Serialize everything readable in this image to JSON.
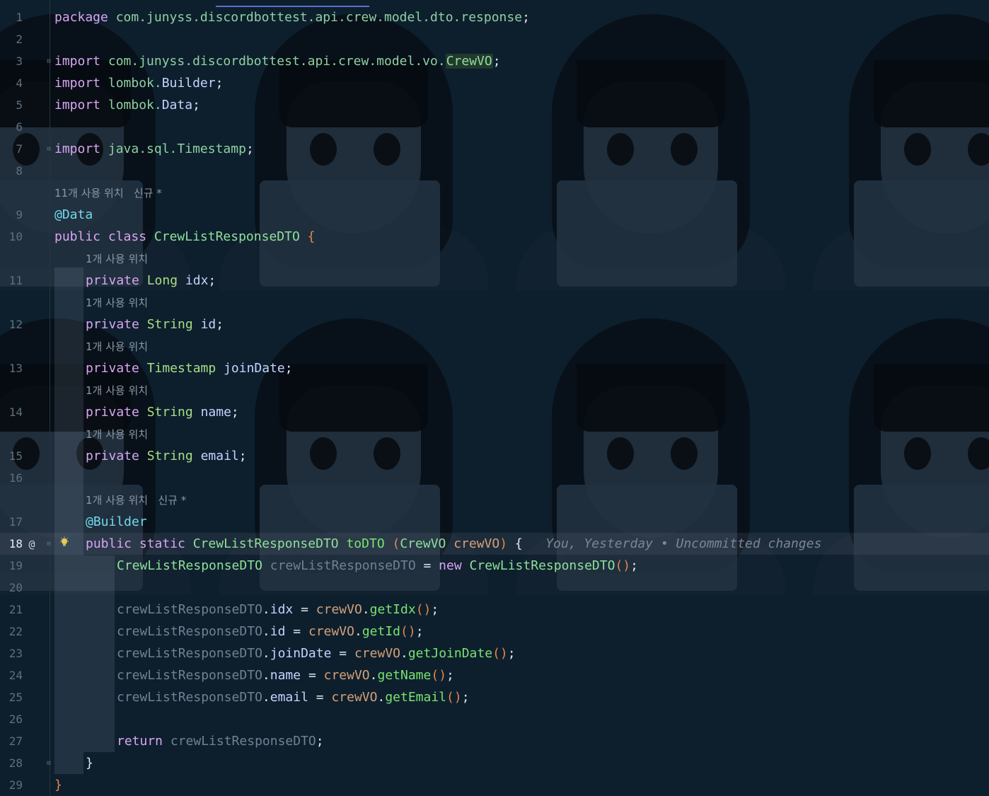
{
  "editor": {
    "current_line": 18,
    "lines": [
      {
        "n": "1",
        "parts": [
          {
            "t": "package ",
            "c": "kw"
          },
          {
            "t": "com.junyss.discordbottest.api.crew.model.dto.response",
            "c": "pkg"
          },
          {
            "t": ";",
            "c": "plain"
          }
        ]
      },
      {
        "n": "2",
        "parts": []
      },
      {
        "n": "3",
        "fold": true,
        "parts": [
          {
            "t": "import ",
            "c": "kw"
          },
          {
            "t": "com.junyss.discordbottest.api.crew.model.vo.",
            "c": "pkg"
          },
          {
            "t": "CrewVO",
            "c": "cls",
            "box": true
          },
          {
            "t": ";",
            "c": "plain"
          }
        ]
      },
      {
        "n": "4",
        "parts": [
          {
            "t": "import ",
            "c": "kw"
          },
          {
            "t": "lombok.",
            "c": "pkg"
          },
          {
            "t": "Builder",
            "c": "field"
          },
          {
            "t": ";",
            "c": "plain"
          }
        ]
      },
      {
        "n": "5",
        "parts": [
          {
            "t": "import ",
            "c": "kw"
          },
          {
            "t": "lombok.",
            "c": "pkg"
          },
          {
            "t": "Data",
            "c": "field"
          },
          {
            "t": ";",
            "c": "plain"
          }
        ]
      },
      {
        "n": "6",
        "parts": []
      },
      {
        "n": "7",
        "fold": true,
        "parts": [
          {
            "t": "import ",
            "c": "kw"
          },
          {
            "t": "java.sql.Timestamp",
            "c": "pkg"
          },
          {
            "t": ";",
            "c": "plain"
          }
        ]
      },
      {
        "n": "8",
        "parts": []
      },
      {
        "hint": "11개 사용 위치   신규 *",
        "indent": 0
      },
      {
        "n": "9",
        "parts": [
          {
            "t": "@Data",
            "c": "ann"
          }
        ]
      },
      {
        "n": "10",
        "parts": [
          {
            "t": "public class ",
            "c": "kw"
          },
          {
            "t": "CrewListResponseDTO ",
            "c": "cls"
          },
          {
            "t": "{",
            "c": "brace"
          }
        ]
      },
      {
        "hint": "1개 사용 위치",
        "indent": 1
      },
      {
        "n": "11",
        "indent": 1,
        "parts": [
          {
            "t": "private ",
            "c": "kw"
          },
          {
            "t": "Long ",
            "c": "type"
          },
          {
            "t": "idx",
            "c": "field"
          },
          {
            "t": ";",
            "c": "plain"
          }
        ]
      },
      {
        "hint": "1개 사용 위치",
        "indent": 1
      },
      {
        "n": "12",
        "indent": 1,
        "parts": [
          {
            "t": "private ",
            "c": "kw"
          },
          {
            "t": "String ",
            "c": "type"
          },
          {
            "t": "id",
            "c": "field"
          },
          {
            "t": ";",
            "c": "plain"
          }
        ]
      },
      {
        "hint": "1개 사용 위치",
        "indent": 1
      },
      {
        "n": "13",
        "indent": 1,
        "parts": [
          {
            "t": "private ",
            "c": "kw"
          },
          {
            "t": "Timestamp ",
            "c": "type"
          },
          {
            "t": "joinDate",
            "c": "field"
          },
          {
            "t": ";",
            "c": "plain"
          }
        ]
      },
      {
        "hint": "1개 사용 위치",
        "indent": 1
      },
      {
        "n": "14",
        "indent": 1,
        "parts": [
          {
            "t": "private ",
            "c": "kw"
          },
          {
            "t": "String ",
            "c": "type"
          },
          {
            "t": "name",
            "c": "field"
          },
          {
            "t": ";",
            "c": "plain"
          }
        ]
      },
      {
        "hint": "1개 사용 위치",
        "indent": 1
      },
      {
        "n": "15",
        "indent": 1,
        "parts": [
          {
            "t": "private ",
            "c": "kw"
          },
          {
            "t": "String ",
            "c": "type"
          },
          {
            "t": "email",
            "c": "field"
          },
          {
            "t": ";",
            "c": "plain"
          }
        ]
      },
      {
        "n": "16",
        "parts": []
      },
      {
        "hint": "1개 사용 위치   신규 *",
        "indent": 1
      },
      {
        "n": "17",
        "indent": 1,
        "parts": [
          {
            "t": "@Builder",
            "c": "ann"
          }
        ]
      },
      {
        "n": "18",
        "indent": 1,
        "at": "@",
        "fold": true,
        "bulb": true,
        "current": true,
        "parts": [
          {
            "t": "public static ",
            "c": "kw"
          },
          {
            "t": "CrewListResponseDTO ",
            "c": "cls"
          },
          {
            "t": "toDTO ",
            "c": "fn"
          },
          {
            "t": "(",
            "c": "brace"
          },
          {
            "t": "CrewVO ",
            "c": "cls"
          },
          {
            "t": "crewVO",
            "c": "param"
          },
          {
            "t": ") ",
            "c": "brace"
          },
          {
            "t": "{",
            "c": "plain"
          },
          {
            "t": "   You, Yesterday • Uncommitted changes",
            "c": "blame"
          }
        ]
      },
      {
        "n": "19",
        "indent": 2,
        "parts": [
          {
            "t": "CrewListResponseDTO ",
            "c": "cls"
          },
          {
            "t": "crewListResponseDTO",
            "c": "local"
          },
          {
            "t": " = ",
            "c": "plain"
          },
          {
            "t": "new ",
            "c": "kw"
          },
          {
            "t": "CrewListResponseDTO",
            "c": "cls"
          },
          {
            "t": "()",
            "c": "brace"
          },
          {
            "t": ";",
            "c": "plain"
          }
        ]
      },
      {
        "n": "20",
        "parts": []
      },
      {
        "n": "21",
        "indent": 2,
        "parts": [
          {
            "t": "crewListResponseDTO",
            "c": "local"
          },
          {
            "t": ".",
            "c": "plain"
          },
          {
            "t": "idx",
            "c": "field"
          },
          {
            "t": " = ",
            "c": "plain"
          },
          {
            "t": "crewVO",
            "c": "param"
          },
          {
            "t": ".",
            "c": "plain"
          },
          {
            "t": "getIdx",
            "c": "fn"
          },
          {
            "t": "()",
            "c": "brace"
          },
          {
            "t": ";",
            "c": "plain"
          }
        ]
      },
      {
        "n": "22",
        "indent": 2,
        "parts": [
          {
            "t": "crewListResponseDTO",
            "c": "local"
          },
          {
            "t": ".",
            "c": "plain"
          },
          {
            "t": "id",
            "c": "field"
          },
          {
            "t": " = ",
            "c": "plain"
          },
          {
            "t": "crewVO",
            "c": "param"
          },
          {
            "t": ".",
            "c": "plain"
          },
          {
            "t": "getId",
            "c": "fn"
          },
          {
            "t": "()",
            "c": "brace"
          },
          {
            "t": ";",
            "c": "plain"
          }
        ]
      },
      {
        "n": "23",
        "indent": 2,
        "parts": [
          {
            "t": "crewListResponseDTO",
            "c": "local"
          },
          {
            "t": ".",
            "c": "plain"
          },
          {
            "t": "joinDate",
            "c": "field"
          },
          {
            "t": " = ",
            "c": "plain"
          },
          {
            "t": "crewVO",
            "c": "param"
          },
          {
            "t": ".",
            "c": "plain"
          },
          {
            "t": "getJoinDate",
            "c": "fn"
          },
          {
            "t": "()",
            "c": "brace"
          },
          {
            "t": ";",
            "c": "plain"
          }
        ]
      },
      {
        "n": "24",
        "indent": 2,
        "parts": [
          {
            "t": "crewListResponseDTO",
            "c": "local"
          },
          {
            "t": ".",
            "c": "plain"
          },
          {
            "t": "name",
            "c": "field"
          },
          {
            "t": " = ",
            "c": "plain"
          },
          {
            "t": "crewVO",
            "c": "param"
          },
          {
            "t": ".",
            "c": "plain"
          },
          {
            "t": "getName",
            "c": "fn"
          },
          {
            "t": "()",
            "c": "brace"
          },
          {
            "t": ";",
            "c": "plain"
          }
        ]
      },
      {
        "n": "25",
        "indent": 2,
        "parts": [
          {
            "t": "crewListResponseDTO",
            "c": "local"
          },
          {
            "t": ".",
            "c": "plain"
          },
          {
            "t": "email",
            "c": "field"
          },
          {
            "t": " = ",
            "c": "plain"
          },
          {
            "t": "crewVO",
            "c": "param"
          },
          {
            "t": ".",
            "c": "plain"
          },
          {
            "t": "getEmail",
            "c": "fn"
          },
          {
            "t": "()",
            "c": "brace"
          },
          {
            "t": ";",
            "c": "plain"
          }
        ]
      },
      {
        "n": "26",
        "parts": []
      },
      {
        "n": "27",
        "indent": 2,
        "parts": [
          {
            "t": "return ",
            "c": "kw"
          },
          {
            "t": "crewListResponseDTO",
            "c": "local"
          },
          {
            "t": ";",
            "c": "plain"
          }
        ]
      },
      {
        "n": "28",
        "indent": 1,
        "fold": true,
        "parts": [
          {
            "t": "}",
            "c": "plain"
          }
        ]
      },
      {
        "n": "29",
        "parts": [
          {
            "t": "}",
            "c": "brace"
          }
        ]
      }
    ]
  }
}
